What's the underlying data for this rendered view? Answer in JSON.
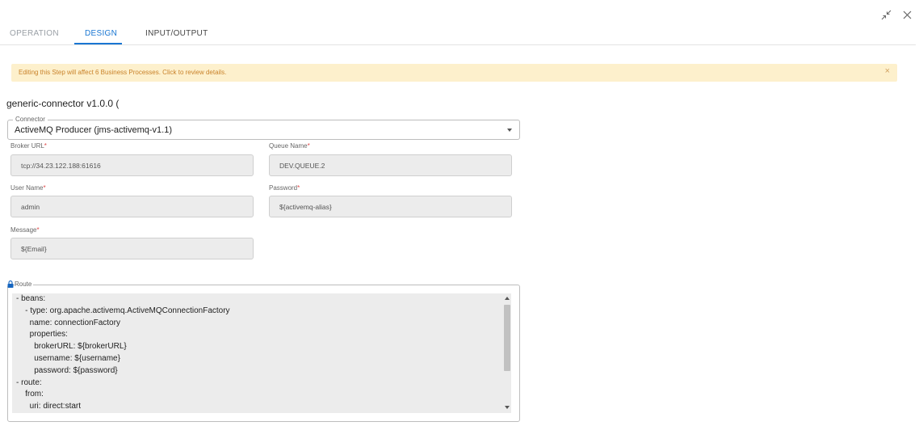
{
  "tabs": [
    {
      "label": "OPERATION",
      "state": "inactive"
    },
    {
      "label": "DESIGN",
      "state": "active"
    },
    {
      "label": "INPUT/OUTPUT",
      "state": "inactive"
    }
  ],
  "window_icons": [
    "collapse-icon",
    "close-icon"
  ],
  "banner": {
    "text": "Editing this Step will affect 6 Business Processes. Click to review details.",
    "close": "×",
    "icon": "close-icon"
  },
  "heading": "generic-connector v1.0.0 (",
  "connector": {
    "label": "Connector",
    "value": "ActiveMQ Producer (jms-activemq-v1.1)",
    "icon": "caret-down-icon"
  },
  "fields": {
    "broker_url": {
      "label": "Broker URL",
      "required": "*",
      "value": "tcp://34.23.122.188:61616"
    },
    "queue_name": {
      "label": "Queue Name",
      "required": "*",
      "value": "DEV.QUEUE.2"
    },
    "user_name": {
      "label": "User Name",
      "required": "*",
      "value": "admin"
    },
    "password": {
      "label": "Password",
      "required": "*",
      "value": "${activemq-alias}"
    },
    "message": {
      "label": "Message",
      "required": "*",
      "value": "${Email}"
    }
  },
  "route": {
    "label": "Route",
    "icon": "lock-icon",
    "lines": [
      "- beans:",
      "    - type: org.apache.activemq.ActiveMQConnectionFactory",
      "      name: connectionFactory",
      "      properties:",
      "        brokerURL: ${brokerURL}",
      "        username: ${username}",
      "        password: ${password}",
      "- route:",
      "    from:",
      "      uri: direct:start"
    ]
  },
  "colors": {
    "accent": "#1976d2",
    "banner_bg": "#fdf0cc",
    "banner_text": "#c9822a",
    "required": "#e04848",
    "field_bg": "#ececec"
  }
}
